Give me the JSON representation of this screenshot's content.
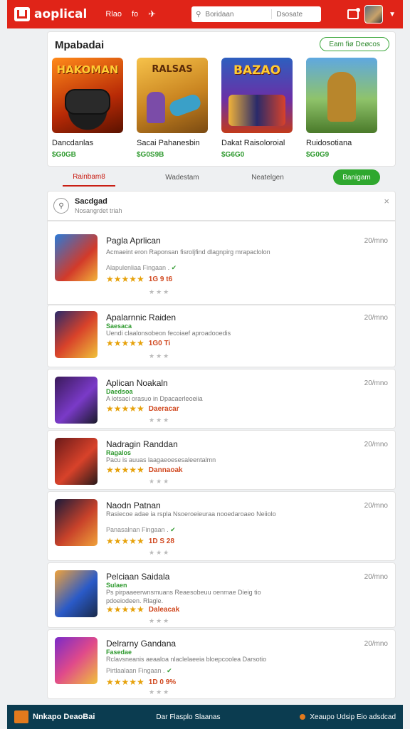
{
  "header": {
    "brand": "aoplical",
    "nav": [
      "Rlao",
      "fo"
    ],
    "search_placeholder": "Boridaan",
    "search_scope": "Dsosate",
    "colors": {
      "header_bg": "#e02418",
      "footer_bg": "#0b3c50",
      "accent_green": "#2fa82f"
    }
  },
  "featured": {
    "title": "Mpabadai",
    "see_all": "Eam fiø Deøcos",
    "games": [
      {
        "cover_text": "HAKOMAN",
        "name": "Dancdanlas",
        "price": "$G0GB"
      },
      {
        "cover_text": "RALSAS",
        "name": "Sacai Pahanesbin",
        "price": "$G0S9B"
      },
      {
        "cover_text": "BAZAO",
        "name": "Dakat Raisoloroial",
        "price": "$G6G0"
      },
      {
        "cover_text": "",
        "name": "Ruidosotiana",
        "price": "$G0G9"
      }
    ]
  },
  "tabs": {
    "items": [
      "Rainbam8",
      "Wadestam",
      "Neatelgen"
    ],
    "button": "Banigam"
  },
  "list_header": {
    "title": "Sacdgad",
    "subtitle": "Nosangrdet triah"
  },
  "apps": [
    {
      "title": "Pagla Aprlican",
      "sub": "",
      "desc": "Acmaeint eron Raponsan fisroljfind dlagnpirg mrapaclolon",
      "meta": "Alapulenliaa Fingaan .",
      "rating": "1G 9 t6",
      "time": "20/mno"
    },
    {
      "title": "Apalarnnic Raiden",
      "sub": "Saesaca",
      "desc": "Uendi claalonsobeon fecoiaef aproadooedis",
      "meta": "",
      "rating": "1G0 Ti",
      "time": "20/mno"
    },
    {
      "title": "Aplican Noakaln",
      "sub": "Daedsoa",
      "desc": "A lotsaci orasuo in Dpacaerleoeiia",
      "meta": "",
      "rating": "Daeracar",
      "time": "20/mno"
    },
    {
      "title": "Nadragin Randdan",
      "sub": "Ragalos",
      "desc": "Pacu is auuas laagaeoesesaleentalmn",
      "meta": "",
      "rating": "Dannaoak",
      "time": "20/mno"
    },
    {
      "title": "Naodn Patnan",
      "sub": "",
      "desc": "Rasiecoe adae ia rspla Nsoeroeieuraa nooedaroaeo Neiiolo",
      "meta": "Panasalnan Fingaan .",
      "rating": "1D S 28",
      "time": "20/mno"
    },
    {
      "title": "Pelciaan Saidala",
      "sub": "Sulaen",
      "desc": "Ps pirpaaeerwnsmuans Reaesobeuu oenmae Dieig tio pdoeiodeen. Rlagle.",
      "meta": "",
      "rating": "Daleacak",
      "time": "20/mno"
    },
    {
      "title": "Delrarny Gandana",
      "sub": "Fasedae",
      "desc": "Rclavsneanis aeaaloa nlaclelaeeia bloepcoolea Darsotio",
      "meta": "Pirtlaalaan Fingaan .",
      "rating": "1D 0 9%",
      "time": "20/mno"
    }
  ],
  "footer": {
    "brand": "Nnkapo DeaoBai",
    "center": "Dar Flasplo Slaanas",
    "right": "Xeaupo Udsip Eio adsdcad"
  }
}
